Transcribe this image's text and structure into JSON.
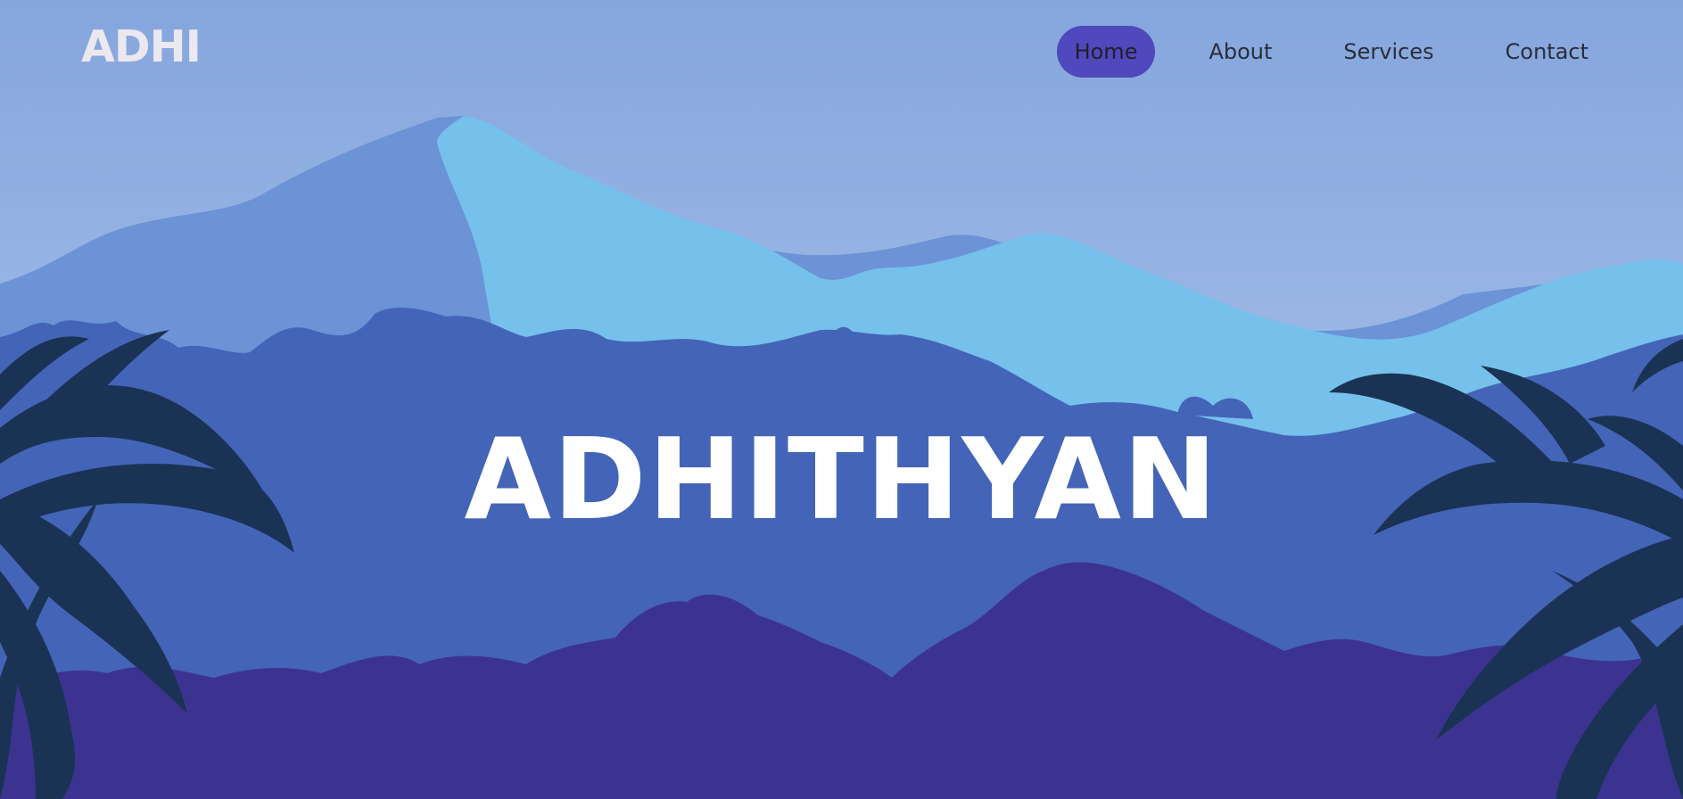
{
  "brand": {
    "name": "ADHI"
  },
  "nav": {
    "items": [
      {
        "label": "Home",
        "active": true
      },
      {
        "label": "About",
        "active": false
      },
      {
        "label": "Services",
        "active": false
      },
      {
        "label": "Contact",
        "active": false
      }
    ]
  },
  "hero": {
    "title": "ADHITHYAN"
  },
  "colors": {
    "sky_top": "#85a6dd",
    "sky_bottom": "#b5ccee",
    "mountain_back": "#6b93d6",
    "mountain_front": "#76c0ec",
    "forest_mid": "#4464b8",
    "forest_front": "#3c3391",
    "palm_leaves": "#1a3354",
    "nav_active_bg": "#5048bd",
    "nav_text": "#2b2d3a",
    "brand_text": "#ece8f0",
    "title_text": "#ffffff"
  }
}
